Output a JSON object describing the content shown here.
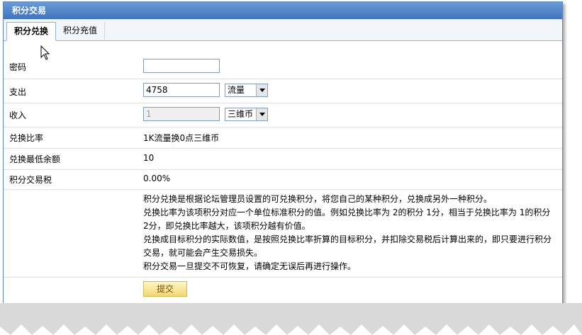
{
  "window": {
    "title": "积分交易"
  },
  "tabs": [
    {
      "label": "积分兑换",
      "active": true
    },
    {
      "label": "积分充值",
      "active": false
    }
  ],
  "form": {
    "password_label": "密码",
    "password_value": "",
    "pay_label": "支出",
    "pay_value": "4758",
    "pay_unit": "流量",
    "income_label": "收入",
    "income_value": "1",
    "income_unit": "三维币",
    "rate_label": "兑换比率",
    "rate_value": "1K流量换0点三维币",
    "min_label": "兑换最低余额",
    "min_value": "10",
    "tax_label": "积分交易税",
    "tax_value": "0.00%"
  },
  "description": {
    "line1": "积分兑换是根据论坛管理员设置的可兑换积分，将您自己的某种积分，兑换成另外一种积分。",
    "line2": "兑换比率为该项积分对应一个单位标准积分的值。例如兑换比率为 2的积分 1分，相当于兑换比率为 1的积分 2分，即兑换比率越大，该项积分越有价值。",
    "line3": "兑换成目标积分的实际数值，是按照兑换比率折算的目标积分，并扣除交易税后计算出来的，即只要进行积分交易，就可能会产生交易损失。",
    "line4": "积分交易一旦提交不可恢复，请确定无误后再进行操作。"
  },
  "submit_label": "提交",
  "colors": {
    "titlebar": "#3f74bd",
    "border": "#5b8bbd",
    "submit": "#f2d778"
  }
}
